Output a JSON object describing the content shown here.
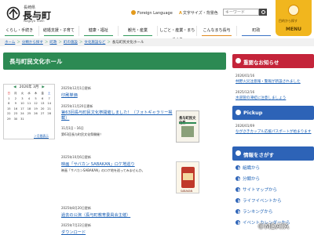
{
  "header": {
    "logo_small": "長崎県",
    "logo_big": "長与町",
    "logo_roman": "Nagayo Town",
    "foreign_language": "Foreign Language",
    "font_size_label": "文字サイズ・背景色",
    "search_placeholder": "キーワード",
    "menu_caption": "目的から探す",
    "menu_label": "MENU"
  },
  "gnav": [
    "くらし・手続き",
    "結婚支援・子育て",
    "健康・福祉",
    "観光・産業",
    "しごと・産業・まちづくり",
    "こんなまち長与",
    "町政"
  ],
  "breadcrumb": [
    "ホーム",
    "分類から探す",
    "町政",
    "町の施設",
    "文化施設など",
    "長与町民文化ホール"
  ],
  "page_title": "長与町民文化ホール",
  "calendar": {
    "year_month": "2026年 3月",
    "weekdays": [
      "日",
      "月",
      "火",
      "水",
      "木",
      "金",
      "土"
    ],
    "rows": [
      [
        "1",
        "2",
        "3",
        "4",
        "5",
        "6",
        "7"
      ],
      [
        "8",
        "9",
        "10",
        "11",
        "12",
        "13",
        "14"
      ],
      [
        "15",
        "16",
        "17",
        "18",
        "19",
        "20",
        "21"
      ],
      [
        "22",
        "23",
        "24",
        "25",
        "26",
        "27",
        "28"
      ],
      [
        "29",
        "30",
        "31",
        "",
        "",
        "",
        ""
      ]
    ],
    "more": "＞月間表示"
  },
  "news": [
    {
      "date": "2025年12月1日更新",
      "title": "印刷単価",
      "text": ""
    },
    {
      "date": "2025年11月20日更新",
      "title": "第63回長与町民文化祭開催しました！（フォトギャラリー掲載）",
      "text1": "11月1日・16日",
      "text2": "第63回長与町民文化祭開催！"
    },
    {
      "date": "2025年10月6日更新",
      "title": "映画「サバカン SABAKAN」ロケ地巡り",
      "text": "映画「サバカンSABAKAN」のロケ地を巡ってみませんか。"
    },
    {
      "date": "2025年8月20日更新",
      "title": "過去の公演（長与町教育委員会主催）",
      "text": ""
    },
    {
      "date": "2025年7月22日更新",
      "title": "ダウンロード",
      "text": ""
    }
  ],
  "thumb1": {
    "title": "長与町民文化祭"
  },
  "thumb2": {
    "label": "SABAKAN"
  },
  "sidebar": {
    "notice_title": "重要なお知らせ",
    "notices": [
      {
        "date": "2026/01/16",
        "title": "林野火災注意報・警報が新設されました"
      },
      {
        "date": "2025/12/16",
        "title": "水道管の凍結に注意しましょう"
      }
    ],
    "pickup_title": "Pickup",
    "pickups": [
      {
        "date": "2026/01/09",
        "title": "ながさきカップル応援パスポートが始まります"
      }
    ],
    "info_title": "情報をさがす",
    "info_items": [
      "組織から",
      "分類から",
      "サイトマップから",
      "ライフイベントから",
      "ランキングから",
      "イベントカレンダーから"
    ]
  },
  "copyright": "©MDATA"
}
